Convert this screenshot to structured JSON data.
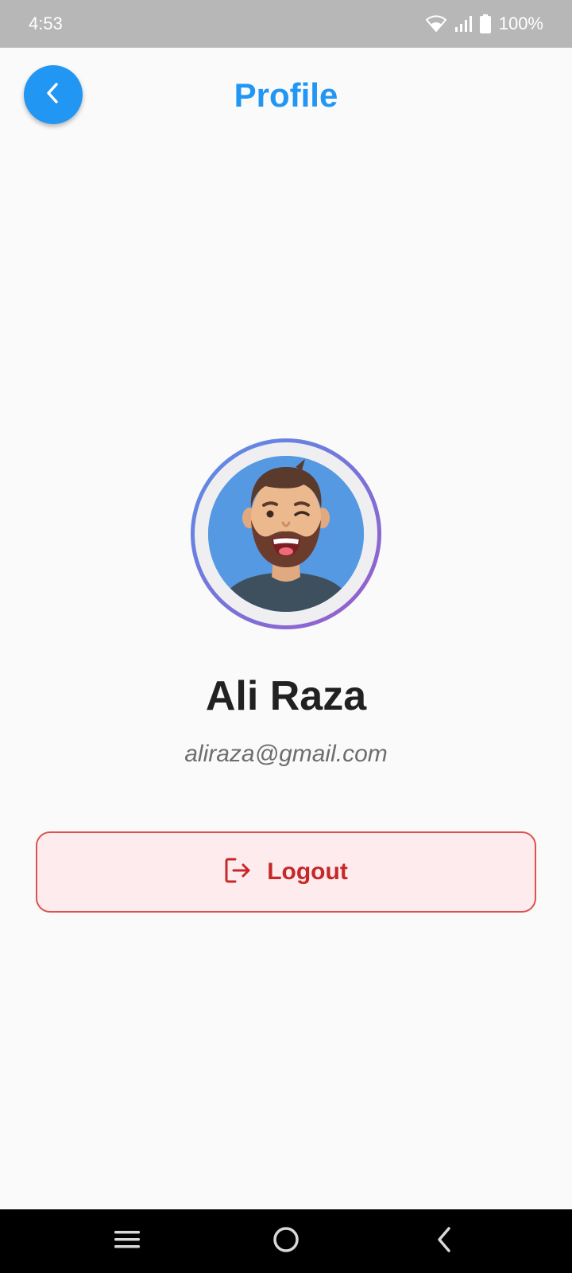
{
  "status_bar": {
    "time": "4:53",
    "battery_percent": "100%",
    "icons": [
      "wifi-icon",
      "signal-icon",
      "battery-icon"
    ]
  },
  "header": {
    "title": "Profile",
    "back_icon": "chevron-left-icon"
  },
  "profile": {
    "name": "Ali Raza",
    "email": "aliraza@gmail.com",
    "avatar": "bearded-man-winking-avatar"
  },
  "actions": {
    "logout_label": "Logout",
    "logout_icon": "logout-icon"
  },
  "nav_bar": {
    "buttons": [
      "menu-icon",
      "home-icon",
      "back-icon"
    ]
  },
  "colors": {
    "accent": "#2196f3",
    "logout_text": "#c62828",
    "logout_border": "#d9534f",
    "logout_bg": "#feebee",
    "status_bar_bg": "#b7b7b7"
  }
}
